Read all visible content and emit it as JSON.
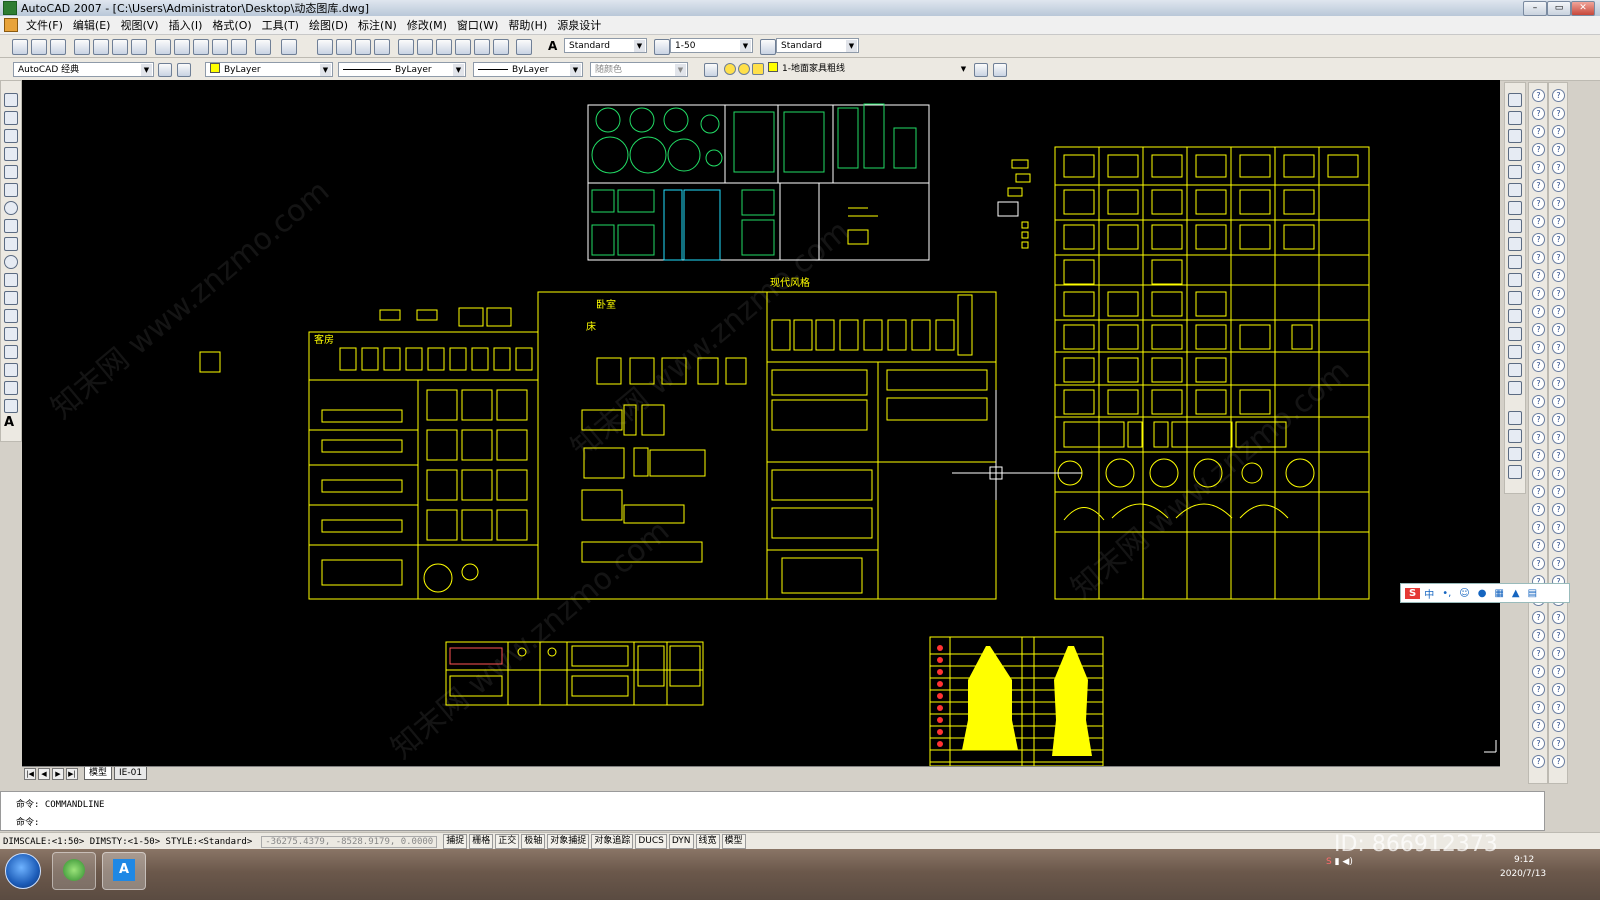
{
  "window": {
    "title": "AutoCAD 2007 - [C:\\Users\\Administrator\\Desktop\\动态图库.dwg]",
    "controls": [
      "–",
      "▭",
      "✕"
    ]
  },
  "menu": {
    "items": [
      "文件(F)",
      "编辑(E)",
      "视图(V)",
      "插入(I)",
      "格式(O)",
      "工具(T)",
      "绘图(D)",
      "标注(N)",
      "修改(M)",
      "窗口(W)",
      "帮助(H)",
      "源泉设计"
    ]
  },
  "toolbar1": {
    "text_style": "Standard",
    "dim_style": "1-50",
    "table_style": "Standard"
  },
  "toolbar2": {
    "workspace": "AutoCAD 经典",
    "color": "ByLayer",
    "linetype": "ByLayer",
    "lineweight": "ByLayer",
    "plotstyle": "随颜色",
    "layer": "1-地面家具粗线"
  },
  "drawing": {
    "labels": {
      "living": "客房",
      "bedroom": "卧室",
      "bed": "床",
      "modern": "现代风格"
    }
  },
  "tabs": [
    "模型",
    "IE-01"
  ],
  "command": {
    "history": "命令: COMMANDLINE",
    "prompt": "命令:"
  },
  "status": {
    "sysvars": "DIMSCALE:<1:50> DIMSTY:<1-50> STYLE:<Standard>",
    "coords": "-36275.4379, -8528.9179, 0.0000",
    "toggles": [
      "捕捉",
      "栅格",
      "正交",
      "极轴",
      "对象捕捉",
      "对象追踪",
      "DUCS",
      "DYN",
      "线宽",
      "模型"
    ]
  },
  "ime": {
    "label": "中"
  },
  "watermark": {
    "brand": "知末",
    "site": "知末网 www.znzmo.com",
    "id": "ID: 866912373"
  },
  "taskbar": {
    "time": "9:12",
    "date": "2020/7/13"
  },
  "colors": {
    "cad_yellow": "#ffff00",
    "cad_green": "#22dd66",
    "canvas_bg": "#000000"
  }
}
